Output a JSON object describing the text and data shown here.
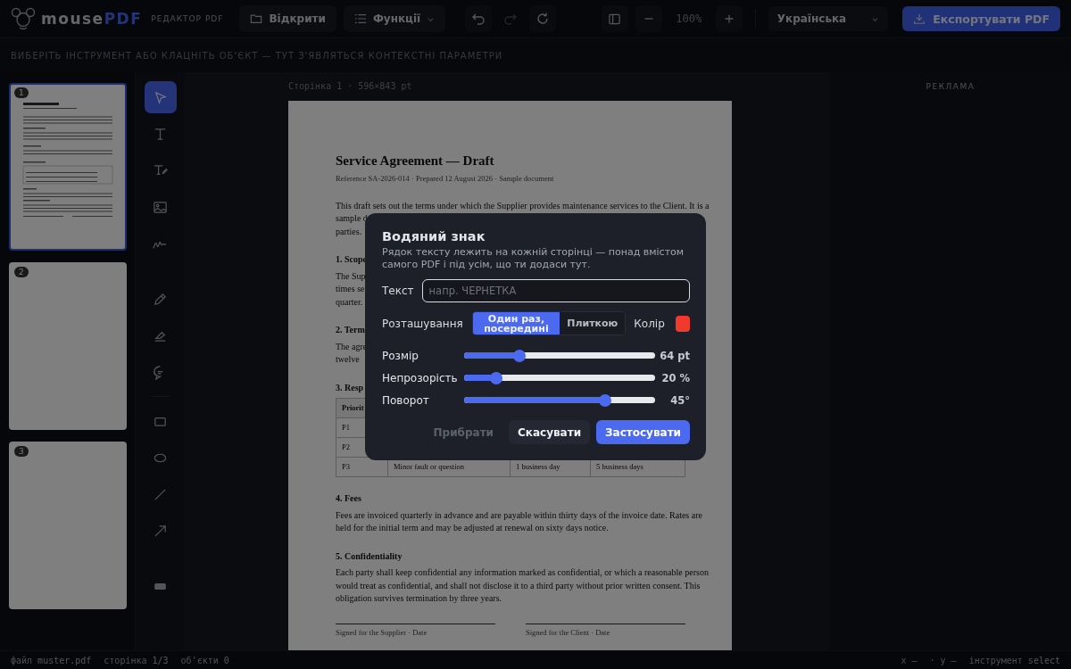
{
  "topbar": {
    "brand": {
      "name": "mouse",
      "accent": "PDF",
      "subtitle": "РЕДАКТОР PDF"
    },
    "open_button": "Відкрити",
    "functions_menu": "Функції",
    "history": [
      {
        "kind": "undo",
        "disabled": false
      },
      {
        "kind": "redo",
        "disabled": true
      },
      {
        "kind": "reload",
        "disabled": false
      }
    ],
    "zoom": "100%",
    "language": "Українська",
    "export_button": "Експортувати PDF"
  },
  "context_bar": "ВИБЕРІТЬ ІНСТРУМЕНТ АБО КЛАЦНІТЬ ОБ'ЄКТ — ТУТ З'ЯВЛЯТЬСЯ КОНТЕКСТНІ ПАРАМЕТРИ",
  "thumbnails": [
    {
      "number": "1",
      "selected": true,
      "kind": "content"
    },
    {
      "number": "2",
      "selected": false,
      "kind": "blank"
    },
    {
      "number": "3",
      "selected": false,
      "kind": "blank"
    }
  ],
  "tools": [
    {
      "kind": "select",
      "selected": true
    },
    {
      "kind": "text",
      "selected": false
    },
    {
      "kind": "text-edit",
      "selected": false
    },
    {
      "kind": "image",
      "selected": false
    },
    {
      "kind": "signature",
      "selected": false
    },
    {
      "kind": "gap"
    },
    {
      "kind": "pencil",
      "selected": false
    },
    {
      "kind": "highlighter",
      "selected": false
    },
    {
      "kind": "comment",
      "selected": false
    },
    {
      "kind": "divider"
    },
    {
      "kind": "rect",
      "selected": false
    },
    {
      "kind": "ellipse",
      "selected": false
    },
    {
      "kind": "line",
      "selected": false
    },
    {
      "kind": "arrow",
      "selected": false
    },
    {
      "kind": "gap"
    },
    {
      "kind": "redact",
      "selected": false
    }
  ],
  "page_caption": "Сторінка 1 · 596×843 pt",
  "document": [
    {
      "kind": "title",
      "lines": [
        "Service Agreement — Draft"
      ]
    },
    {
      "kind": "meta",
      "lines": [
        "Reference SA-2026-014 · Prepared 12 August 2026 · Sample document"
      ]
    },
    {
      "kind": "para",
      "lines": [
        "This draft sets out the terms under which the Supplier provides maintenance services to the Client. It is a",
        "sample d",
        "parties."
      ]
    },
    {
      "kind": "heading",
      "lines": [
        "1. Scope"
      ]
    },
    {
      "kind": "para",
      "lines": [
        "The Sup",
        "times se",
        "quarter."
      ]
    },
    {
      "kind": "heading",
      "lines": [
        "2. Term"
      ]
    },
    {
      "kind": "para",
      "lines": [
        "The agre",
        "twelve"
      ]
    },
    {
      "kind": "heading",
      "lines": [
        "3. Resp"
      ]
    },
    {
      "kind": "table",
      "header": [
        "Priorit"
      ],
      "rows": [
        [
          "P1"
        ],
        [
          "P2"
        ],
        [
          "P3",
          "Minor fault or question",
          "1 business day",
          "5 business days"
        ]
      ]
    },
    {
      "kind": "heading",
      "lines": [
        "4. Fees"
      ]
    },
    {
      "kind": "para",
      "lines": [
        "Fees are invoiced quarterly in advance and are payable within thirty days of the invoice date. Rates are",
        "held for the initial term and may be adjusted at renewal on sixty days notice."
      ]
    },
    {
      "kind": "heading",
      "lines": [
        "5. Confidentiality"
      ]
    },
    {
      "kind": "para",
      "lines": [
        "Each party shall keep confidential any information marked as confidential, or which a reasonable person",
        "would treat as confidential, and shall not disclose it to a third party without prior written consent. This",
        "obligation survives termination by three years."
      ]
    },
    {
      "kind": "signatures",
      "lines": [
        "Signed for the Supplier · Date",
        "Signed for the Client · Date"
      ]
    }
  ],
  "ad_label": "РЕКЛАМА",
  "status_bar": {
    "left": [
      {
        "label": "файл",
        "value": "muster.pdf"
      },
      {
        "label": "сторінка",
        "value": "1/3"
      },
      {
        "label": "об'єкти",
        "value": "0"
      }
    ],
    "right": [
      {
        "label": "x",
        "value": "—"
      },
      {
        "label": "· y",
        "value": "—"
      },
      {
        "label": "інструмент",
        "value": "select"
      }
    ]
  },
  "dialog": {
    "title": "Водяний знак",
    "description": "Рядок тексту лежить на кожній сторінці — понад вмістом самого PDF і під усім, що ти додаси тут.",
    "text_label": "Текст",
    "text_placeholder": "напр. ЧЕРНЕТКА",
    "placement_label": "Розташування",
    "placement_options": [
      {
        "label": "Один раз, посередині",
        "selected": true
      },
      {
        "label": "Плиткою",
        "selected": false
      }
    ],
    "color_label": "Колір",
    "color": "#f03a2e",
    "sliders": [
      {
        "label": "Розмір",
        "level": 0.29,
        "reading": "64 pt"
      },
      {
        "label": "Непрозорість",
        "level": 0.17,
        "reading": "20 %"
      },
      {
        "label": "Поворот",
        "level": 0.74,
        "reading": "45°"
      }
    ],
    "buttons": [
      {
        "label": "Прибрати",
        "kind": "ghost",
        "disabled": true
      },
      {
        "label": "Скасувати",
        "kind": "secondary",
        "disabled": false
      },
      {
        "label": "Застосувати",
        "kind": "primary",
        "disabled": false
      }
    ]
  }
}
